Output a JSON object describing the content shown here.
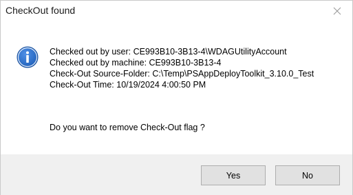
{
  "dialog": {
    "title": "CheckOut found",
    "icon": "info-icon",
    "message_lines": [
      "Checked out by user: CE993B10-3B13-4\\WDAGUtilityAccount",
      "Checked out by machine: CE993B10-3B13-4",
      "Check-Out Source-Folder: C:\\Temp\\PSAppDeployToolkit_3.10.0_Test",
      "Check-Out Time: 10/19/2024 4:00:50 PM"
    ],
    "question": "Do you want to remove Check-Out flag ?",
    "buttons": {
      "yes": "Yes",
      "no": "No"
    }
  },
  "colors": {
    "icon_blue": "#1e5fb8",
    "footer_bg": "#f0f0f0",
    "button_bg": "#e1e1e1",
    "button_border": "#adadad"
  }
}
